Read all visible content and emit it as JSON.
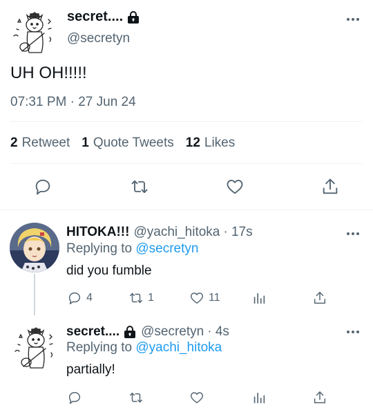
{
  "main_tweet": {
    "display_name": "secret....",
    "handle": "@secretyn",
    "text": "UH OH!!!!!",
    "timestamp": "07:31 PM · 27 Jun 24",
    "stats": [
      {
        "count": "2",
        "label": "Retweet"
      },
      {
        "count": "1",
        "label": "Quote Tweets"
      },
      {
        "count": "12",
        "label": "Likes"
      }
    ],
    "actions": [
      "reply-icon",
      "retweet-icon",
      "like-icon",
      "share-icon"
    ]
  },
  "replies": [
    {
      "display_name": "HITOKA!!!",
      "handle": "@yachi_hitoka",
      "time": "· 17s",
      "replying_prefix": "Replying to ",
      "replying_to": "@secretyn",
      "text": "did you fumble",
      "reply_count": "4",
      "retweet_count": "1",
      "like_count": "11"
    },
    {
      "display_name": "secret....",
      "handle": "@secretyn",
      "time": "· 4s",
      "replying_prefix": "Replying to ",
      "replying_to": "@yachi_hitoka",
      "text": "partially!",
      "reply_count": "",
      "retweet_count": "",
      "like_count": ""
    }
  ],
  "colors": {
    "text": "#0f1419",
    "muted": "#536471",
    "link": "#1d9bf0",
    "divider": "#eff3f4",
    "thread_line": "#cfd9de"
  }
}
